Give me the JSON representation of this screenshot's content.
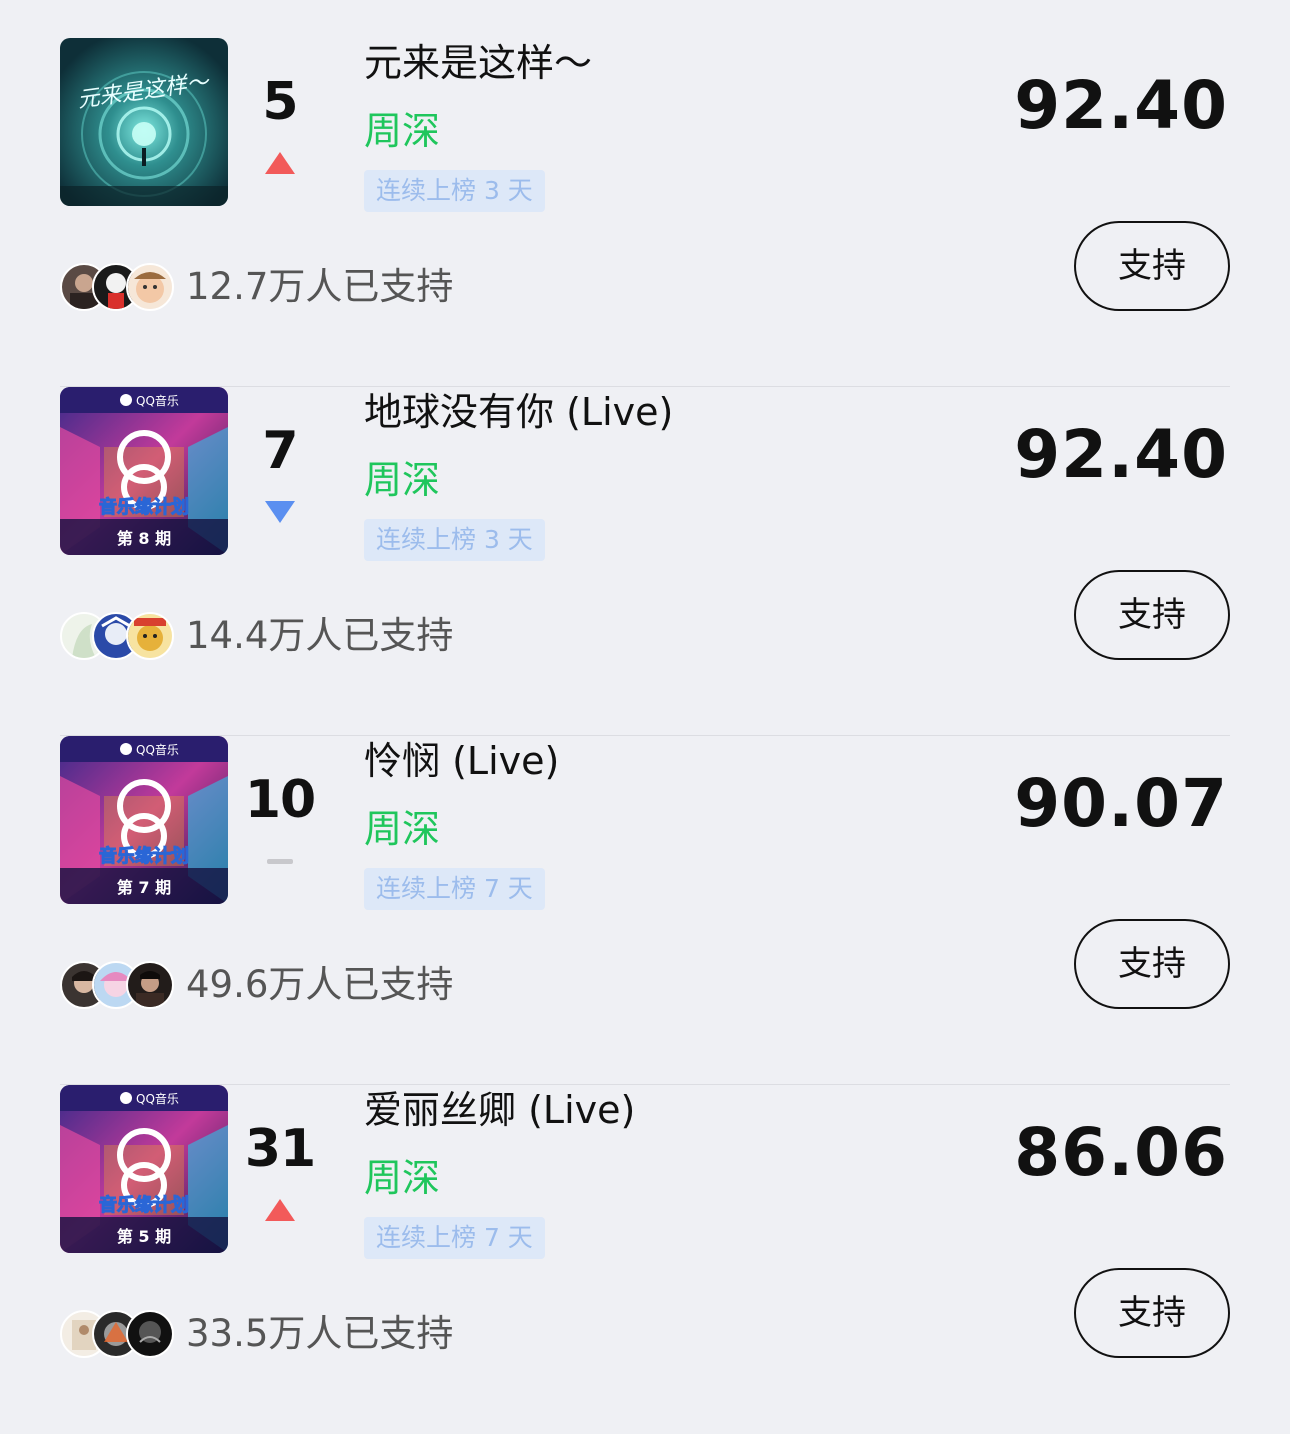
{
  "entries": [
    {
      "rank": "5",
      "trend": "up",
      "title": "元来是这样～",
      "artist": "周深",
      "streak": "连续上榜 3 天",
      "score": "92.40",
      "supporters": "12.7万人已支持",
      "support_label": "支持",
      "cover_text": "元来是这样～",
      "cover_style": "tunnel"
    },
    {
      "rank": "7",
      "trend": "down",
      "title": "地球没有你 (Live)",
      "artist": "周深",
      "streak": "连续上榜 3 天",
      "score": "92.40",
      "supporters": "14.4万人已支持",
      "support_label": "支持",
      "cover_brand": "QQ音乐",
      "cover_show": "音乐缘计划",
      "cover_episode": "第 8 期",
      "cover_style": "stage"
    },
    {
      "rank": "10",
      "trend": "flat",
      "title": "怜悯 (Live)",
      "artist": "周深",
      "streak": "连续上榜 7 天",
      "score": "90.07",
      "supporters": "49.6万人已支持",
      "support_label": "支持",
      "cover_brand": "QQ音乐",
      "cover_show": "音乐缘计划",
      "cover_episode": "第 7 期",
      "cover_style": "stage"
    },
    {
      "rank": "31",
      "trend": "up",
      "title": "爱丽丝卿 (Live)",
      "artist": "周深",
      "streak": "连续上榜 7 天",
      "score": "86.06",
      "supporters": "33.5万人已支持",
      "support_label": "支持",
      "cover_brand": "QQ音乐",
      "cover_show": "音乐缘计划",
      "cover_episode": "第 5 期",
      "cover_style": "stage"
    }
  ],
  "colors": {
    "background": "#eff0f4",
    "artist": "#1fc65c",
    "trend_up": "#f25a5a",
    "trend_down": "#5b8ff0",
    "trend_flat": "#c8c8cc",
    "streak_bg": "#dde8f8",
    "streak_text": "#9cbcec"
  }
}
